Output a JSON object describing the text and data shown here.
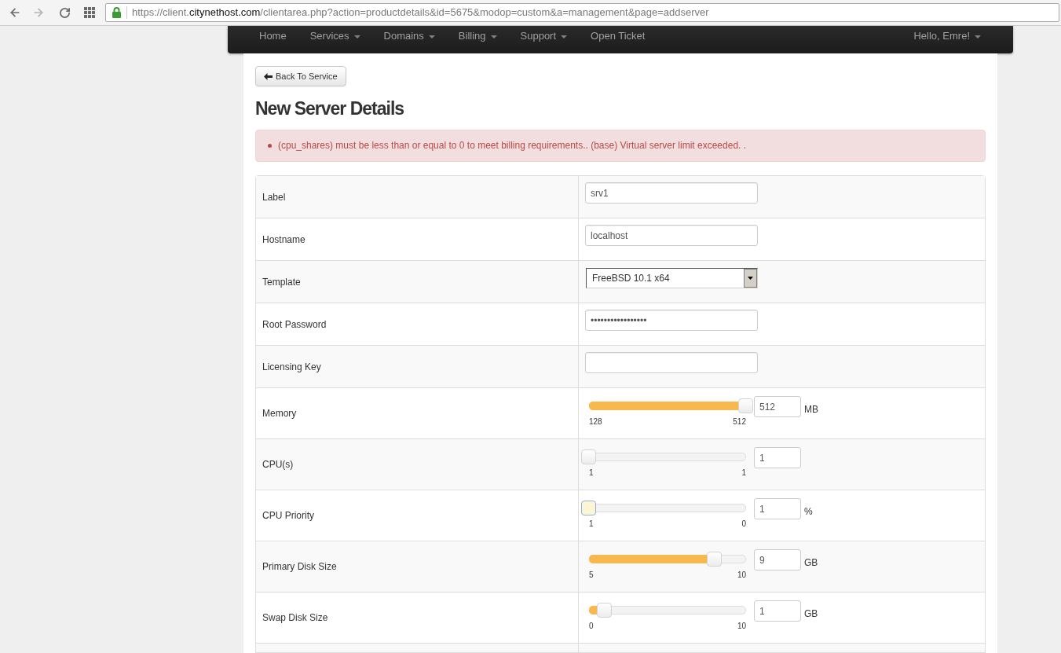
{
  "browser": {
    "url": {
      "start": "https://client.",
      "domain": "citynethost.com",
      "path": "/clientarea.php?action=productdetails&id=5675&modop=custom&a=management&page=addserver"
    }
  },
  "nav": {
    "items": [
      {
        "label": "Home",
        "dropdown": false
      },
      {
        "label": "Services",
        "dropdown": true
      },
      {
        "label": "Domains",
        "dropdown": true
      },
      {
        "label": "Billing",
        "dropdown": true
      },
      {
        "label": "Support",
        "dropdown": true
      },
      {
        "label": "Open Ticket",
        "dropdown": false
      }
    ],
    "user": {
      "label": "Hello, Emre!",
      "dropdown": true
    }
  },
  "back_button": {
    "label": "Back To Service"
  },
  "title": "New Server Details",
  "alert": {
    "messages": [
      "(cpu_shares) must be less than or equal to 0 to meet billing requirements.. (base) Virtual server limit exceeded. ."
    ]
  },
  "form": {
    "rows": [
      {
        "kind": "text",
        "label": "Label",
        "value": "srv1"
      },
      {
        "kind": "text",
        "label": "Hostname",
        "value": "localhost"
      },
      {
        "kind": "select",
        "label": "Template",
        "value": "FreeBSD 10.1 x64"
      },
      {
        "kind": "text",
        "label": "Root Password",
        "value": "•••••••••••••••••"
      },
      {
        "kind": "text",
        "label": "Licensing Key"
      },
      {
        "kind": "slider",
        "label": "Memory",
        "level": 1,
        "min": "128",
        "max": "512",
        "value": "512",
        "unit": "MB",
        "focused": false
      },
      {
        "kind": "slider",
        "label": "CPU(s)",
        "level": 0,
        "min": "1",
        "max": "1",
        "value": "1",
        "focused": false
      },
      {
        "kind": "slider",
        "label": "CPU Priority",
        "level": 0,
        "min": "1",
        "max": "0",
        "value": "1",
        "unit": "%",
        "focused": true
      },
      {
        "kind": "slider",
        "label": "Primary Disk Size",
        "level": 0.8,
        "min": "5",
        "max": "10",
        "value": "9",
        "unit": "GB",
        "focused": false
      },
      {
        "kind": "slider",
        "label": "Swap Disk Size",
        "level": 0.1,
        "min": "0",
        "max": "10",
        "value": "1",
        "unit": "GB",
        "focused": false
      }
    ]
  }
}
